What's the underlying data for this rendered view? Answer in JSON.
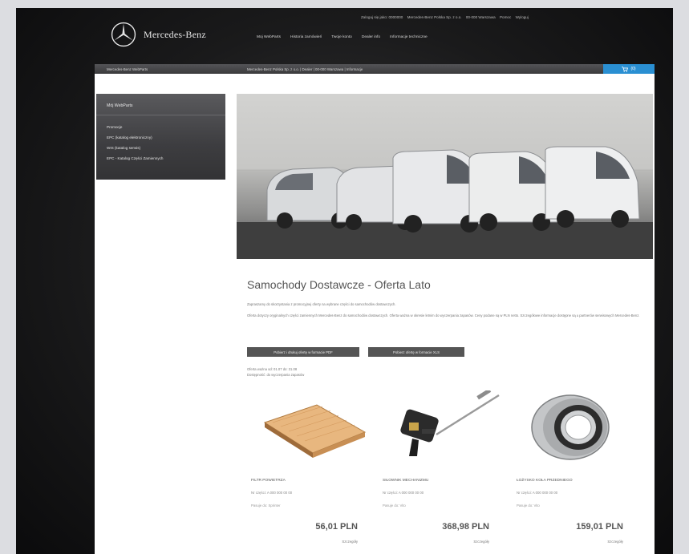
{
  "header": {
    "brand": "Mercedes-Benz",
    "utility_links": [
      "Zaloguj się jako: 0000000",
      "Mercedes-Benz Polska Sp. z o.o.",
      "00-000 Warszawa",
      "Pomoc",
      "Wyloguj"
    ],
    "nav": [
      "Moj WebParts",
      "Historia zamówień",
      "Twoje konto",
      "Dealer info",
      "Informacje techniczne"
    ]
  },
  "strip": {
    "left": "Mercedes-Benz WebParts",
    "middle": "Mercedes-Benz Polska Sp. z o.o. | Dealer | 00-000 Warszawa | Informacje",
    "cart": "(0)"
  },
  "sidebar": {
    "title": "Mój WebParts",
    "items": [
      "Promocje",
      "EPC (katalog elektroniczny)",
      "WIS (katalog serwis)",
      "EPC - Katalog Części Zamiennych"
    ]
  },
  "main": {
    "title": "Samochody Dostawcze - Oferta Lato",
    "intro": "Zapraszamy do skorzystania z promocyjnej oferty na wybrane części do samochodów dostawczych.",
    "description": "Oferta dotyczy oryginalnych części zamiennych Mercedes-Benz do samochodów dostawczych. Oferta ważna w okresie letnim do wyczerpania zapasów. Ceny podane są w PLN netto. Szczegółowe informacje dostępne są u partnerów serwisowych Mercedes-Benz.",
    "button_primary": "Pobierz i drukuj ofertę w formacie PDF",
    "button_secondary": "Pobierz ofertę w formacie XLS",
    "dates_line1": "Oferta ważna od: 01.07 do: 31.08",
    "dates_line2": "Dostępność: do wyczerpania zapasów"
  },
  "products": [
    {
      "name": "FILTR POWIETRZA",
      "code": "Nr części: A 000 000 00 00",
      "note": "Pasuje do: Sprinter",
      "price": "56,01 PLN",
      "more": "Szczegóły"
    },
    {
      "name": "SIŁOWNIK MECHANIZMU",
      "code": "Nr części: A 000 000 00 00",
      "note": "Pasuje do: Vito",
      "price": "368,98 PLN",
      "more": "Szczegóły"
    },
    {
      "name": "ŁOŻYSKO KOŁA PRZEDNIEGO",
      "code": "Nr części: A 000 000 00 00",
      "note": "Pasuje do: Vito",
      "price": "159,01 PLN",
      "more": "Szczegóły"
    }
  ],
  "colors": {
    "cart_blue": "#2a8fd2",
    "sidebar_dark": "#3d3d40",
    "button_dark": "#555555"
  },
  "icons": [
    "mercedes-star-logo",
    "cart-icon"
  ]
}
